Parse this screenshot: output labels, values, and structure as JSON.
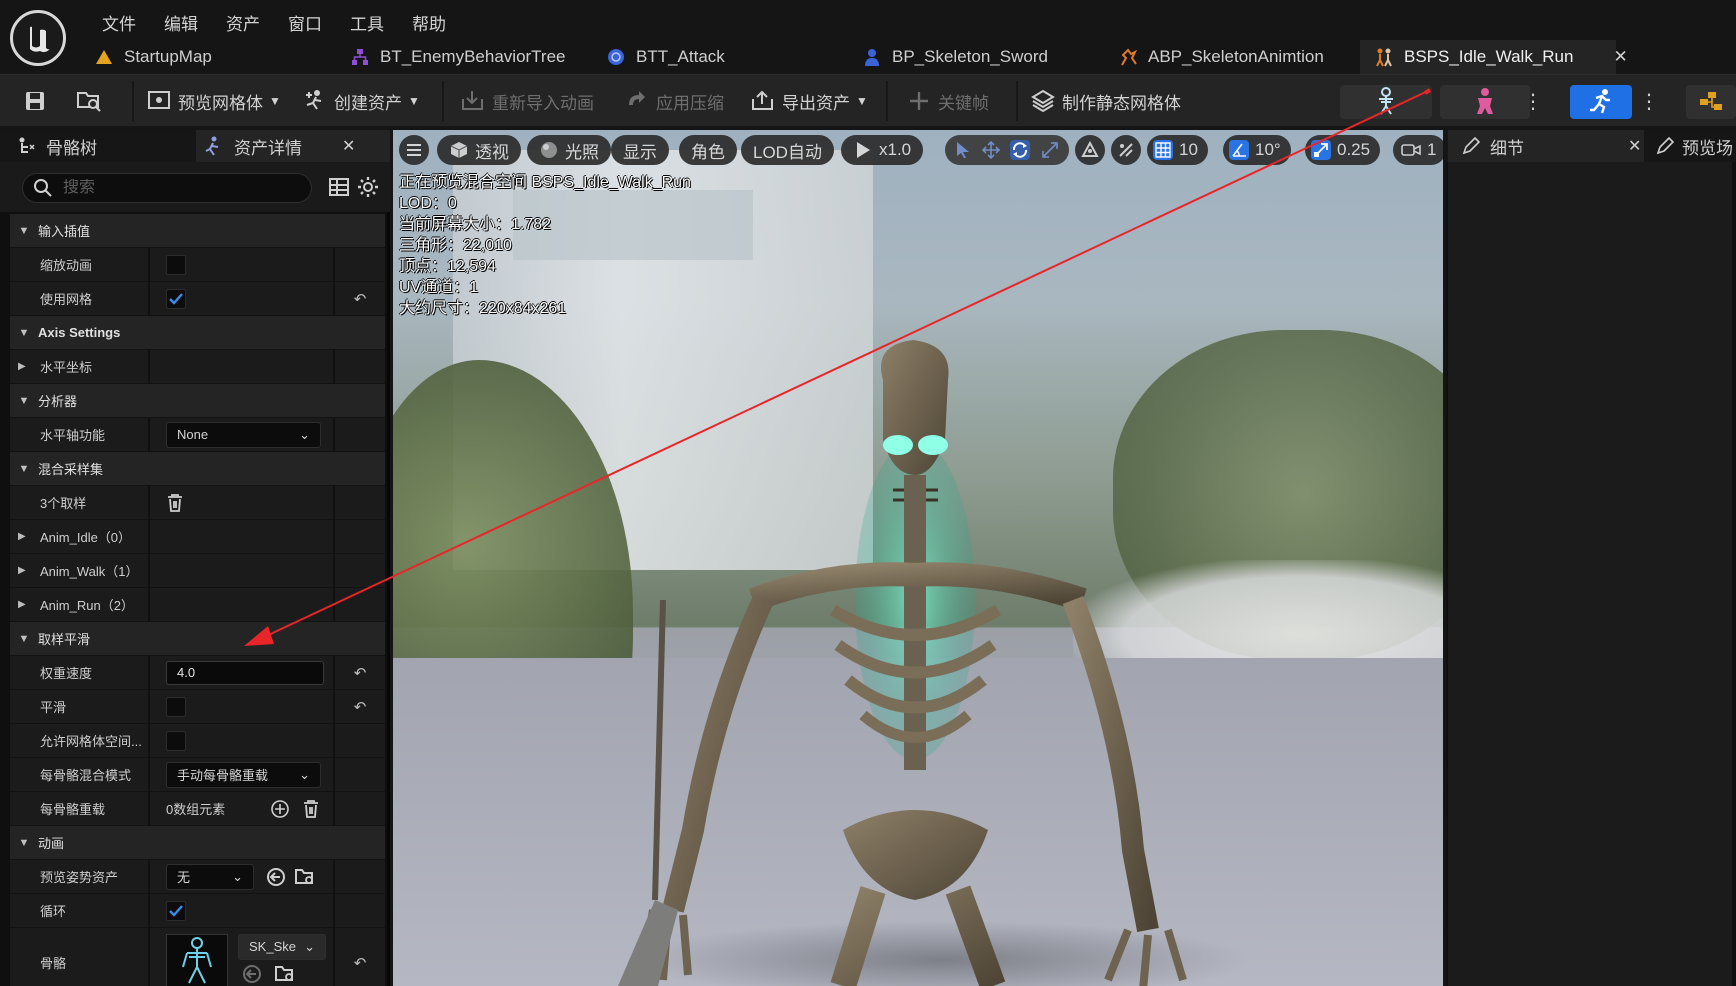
{
  "menu": [
    "文件",
    "编辑",
    "资产",
    "窗口",
    "工具",
    "帮助"
  ],
  "tabs": [
    {
      "label": "StartupMap",
      "icon": "map-icon"
    },
    {
      "label": "BT_EnemyBehaviorTree",
      "icon": "behavior-tree-icon"
    },
    {
      "label": "BTT_Attack",
      "icon": "blueprint-task-icon"
    },
    {
      "label": "BP_Skeleton_Sword",
      "icon": "blueprint-actor-icon"
    },
    {
      "label": "ABP_SkeletonAnimtion",
      "icon": "anim-blueprint-icon"
    },
    {
      "label": "BSPS_Idle_Walk_Run",
      "icon": "blendspace-icon",
      "active": true
    }
  ],
  "toolbar": {
    "preview_mesh": "预览网格体",
    "create_asset": "创建资产",
    "reimport": "重新导入动画",
    "apply_compression": "应用压缩",
    "export_asset": "导出资产",
    "keyframe": "关键帧",
    "make_static_mesh": "制作静态网格体"
  },
  "left_panel": {
    "tab_skeleton": "骨骼树",
    "tab_details": "资产详情",
    "search_placeholder": "搜索",
    "sections": {
      "input_interp": "输入插值",
      "scale_anim": "缩放动画",
      "use_grid": "使用网格",
      "axis_settings": "Axis Settings",
      "horizontal_axis": "水平坐标",
      "analysis": "分析器",
      "h_axis_function": "水平轴功能",
      "h_axis_function_value": "None",
      "blend_samples": "混合采样集",
      "samples_count": "3个取样",
      "anim_idle": "Anim_Idle（0）",
      "anim_walk": "Anim_Walk（1）",
      "anim_run": "Anim_Run（2）",
      "sample_smoothing": "取样平滑",
      "weight_speed": "权重速度",
      "weight_speed_value": "4.0",
      "smoothing": "平滑",
      "allow_mesh_space": "允许网格体空间...",
      "per_bone_mode": "每骨骼混合模式",
      "per_bone_mode_value": "手动每骨骼重载",
      "per_bone_override": "每骨骼重载",
      "per_bone_override_value": "0数组元素",
      "animation": "动画",
      "preview_pose": "预览姿势资产",
      "preview_pose_value": "无",
      "loop": "循环",
      "skeleton": "骨骼",
      "skeleton_value": "SK_Ske"
    }
  },
  "viewport": {
    "perspective": "透视",
    "lighting": "光照",
    "show": "显示",
    "character": "角色",
    "lod": "LOD自动",
    "play_rate": "x1.0",
    "grid_snap": "10",
    "rot_snap": "10°",
    "scale_snap": "0.25",
    "camera_speed": "1",
    "stats": [
      "正在预览混合空间 BSPS_Idle_Walk_Run",
      "LOD：0",
      "当前屏幕大小：1.782",
      "三角形：22,010",
      "顶点：12,594",
      "UV通道：1",
      "大约尺寸：220x84x261"
    ]
  },
  "right_panel": {
    "tab_details": "细节",
    "tab_preview": "预览场"
  },
  "colors": {
    "accent_blue": "#1f6fe5",
    "annotation_arrow": "#e8262a",
    "checkbox_check": "#3d8be8"
  }
}
